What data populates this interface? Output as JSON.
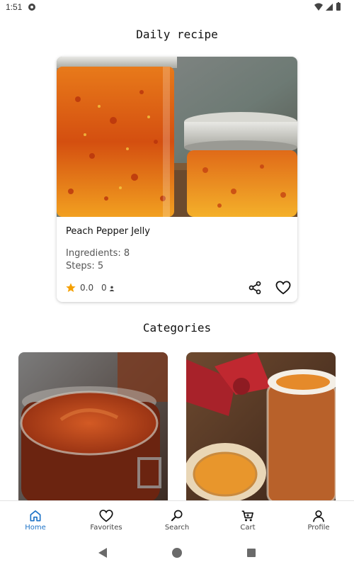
{
  "status_bar": {
    "time": "1:51"
  },
  "daily_section": {
    "title": "Daily recipe"
  },
  "daily_recipe": {
    "name": "Peach Pepper Jelly",
    "ingredients": "Ingredients: 8",
    "steps": "Steps: 5",
    "rating": "0.0",
    "reviews": "0"
  },
  "categories_section": {
    "title": "Categories"
  },
  "bottom_nav": {
    "items": [
      {
        "label": "Home",
        "icon": "home-icon",
        "active": true
      },
      {
        "label": "Favorites",
        "icon": "heart-icon",
        "active": false
      },
      {
        "label": "Search",
        "icon": "search-icon",
        "active": false
      },
      {
        "label": "Cart",
        "icon": "cart-icon",
        "active": false
      },
      {
        "label": "Profile",
        "icon": "person-icon",
        "active": false
      }
    ]
  },
  "colors": {
    "accent": "#1e73c7",
    "star": "#f5a000"
  }
}
